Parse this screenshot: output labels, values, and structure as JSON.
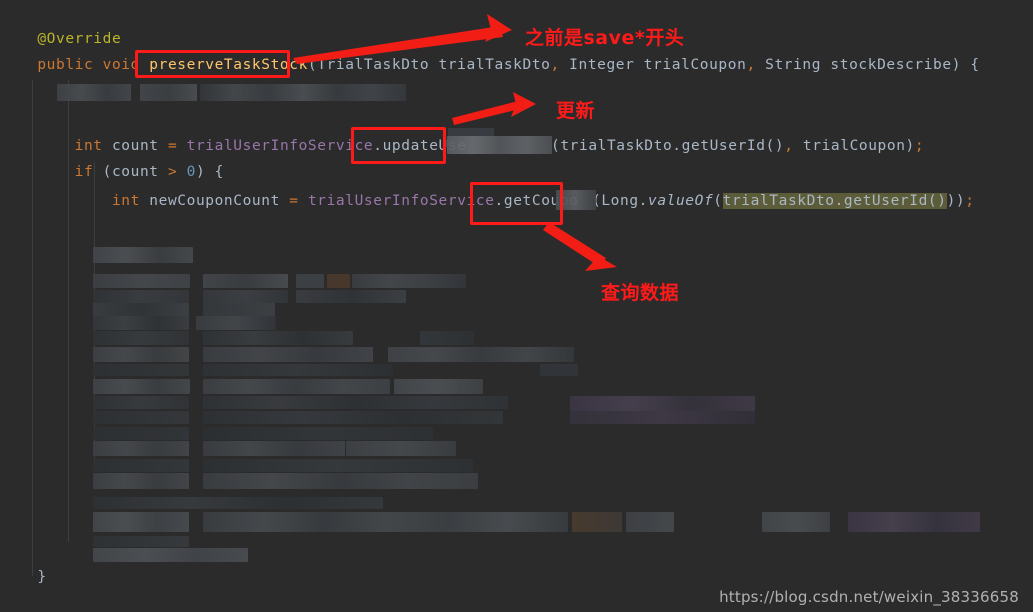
{
  "editor": {
    "background_color": "#2b2b2b",
    "default_text_color": "#a9b7c6",
    "colors": {
      "annotation": "#bbb529",
      "keyword": "#cc7832",
      "method_name": "#ffc66d",
      "field": "#9876aa",
      "number": "#6897bb",
      "selection_highlight": "#5d5c38",
      "annotation_red": "#ff1a1a"
    },
    "code_lines": [
      {
        "id": "line-override",
        "tokens": [
          {
            "text": "    ",
            "style": "plain"
          },
          {
            "text": "@Override",
            "style": "anno"
          }
        ]
      },
      {
        "id": "line-signature",
        "tokens": [
          {
            "text": "    ",
            "style": "plain"
          },
          {
            "text": "public void ",
            "style": "kw"
          },
          {
            "text": "preserveTaskStock",
            "style": "method"
          },
          {
            "text": "(TrialTaskDto trialTaskDto",
            "style": "plain"
          },
          {
            "text": ",",
            "style": "kw"
          },
          {
            "text": " Integer trialCoupon",
            "style": "plain"
          },
          {
            "text": ",",
            "style": "kw"
          },
          {
            "text": " String stockDescribe",
            "style": "plain"
          },
          {
            "text": ")",
            "style": "plain"
          },
          {
            "text": " {",
            "style": "plain"
          }
        ]
      },
      {
        "id": "line-count",
        "tokens": [
          {
            "text": "        ",
            "style": "plain"
          },
          {
            "text": "int",
            "style": "kw"
          },
          {
            "text": " count ",
            "style": "plain"
          },
          {
            "text": "=",
            "style": "kw"
          },
          {
            "text": " ",
            "style": "plain"
          },
          {
            "text": "trialUserInfoService",
            "style": "field"
          },
          {
            "text": ".updateUse",
            "style": "plain"
          }
        ]
      },
      {
        "id": "line-count-tail",
        "tokens": [
          {
            "text": "(trialTaskDto.getUserId()",
            "style": "plain"
          },
          {
            "text": ",",
            "style": "kw"
          },
          {
            "text": " trialCoupon)",
            "style": "plain"
          },
          {
            "text": ";",
            "style": "kw"
          }
        ]
      },
      {
        "id": "line-if",
        "tokens": [
          {
            "text": "        ",
            "style": "plain"
          },
          {
            "text": "if",
            "style": "kw"
          },
          {
            "text": " (count ",
            "style": "plain"
          },
          {
            "text": ">",
            "style": "kw"
          },
          {
            "text": " ",
            "style": "plain"
          },
          {
            "text": "0",
            "style": "num"
          },
          {
            "text": ") {",
            "style": "plain"
          }
        ]
      },
      {
        "id": "line-newcoupon",
        "tokens": [
          {
            "text": "            ",
            "style": "plain"
          },
          {
            "text": "int",
            "style": "kw"
          },
          {
            "text": " newCouponCount ",
            "style": "plain"
          },
          {
            "text": "=",
            "style": "kw"
          },
          {
            "text": " ",
            "style": "plain"
          },
          {
            "text": "trialUserInfoService",
            "style": "field"
          },
          {
            "text": ".getCoupo",
            "style": "plain"
          }
        ]
      },
      {
        "id": "line-newcoupon-tail",
        "tokens": [
          {
            "text": "(Long.",
            "style": "plain"
          },
          {
            "text": "valueOf",
            "style": "ital"
          },
          {
            "text": "(",
            "style": "plain"
          },
          {
            "text": "trialTaskDto.getUserId()",
            "style": "sel"
          },
          {
            "text": "))",
            "style": "plain"
          },
          {
            "text": ";",
            "style": "kw"
          }
        ]
      },
      {
        "id": "line-closing-inner",
        "tokens": [
          {
            "text": "        }",
            "style": "plain"
          }
        ]
      },
      {
        "id": "line-closing-outer",
        "tokens": [
          {
            "text": "    }",
            "style": "plain"
          }
        ]
      }
    ],
    "redacted_note": "blurred code region"
  },
  "annotations": {
    "boxes": [
      {
        "id": "box-preserve-task-stock",
        "target": "preserveTaskStock"
      },
      {
        "id": "box-update-use",
        "target": ".updateUse"
      },
      {
        "id": "box-get-coupon",
        "target": ".getCoupo"
      }
    ],
    "notes": [
      {
        "id": "note-save-prefix",
        "text": "之前是save*开头"
      },
      {
        "id": "note-update",
        "text": "更新"
      },
      {
        "id": "note-query-data",
        "text": "查询数据"
      }
    ],
    "arrows": [
      {
        "id": "arrow-to-save-prefix",
        "direction": "up-right"
      },
      {
        "id": "arrow-to-update",
        "direction": "up-right"
      },
      {
        "id": "arrow-to-query-data",
        "direction": "down-right"
      }
    ]
  },
  "watermark": {
    "text": "https://blog.csdn.net/weixin_38336658"
  }
}
